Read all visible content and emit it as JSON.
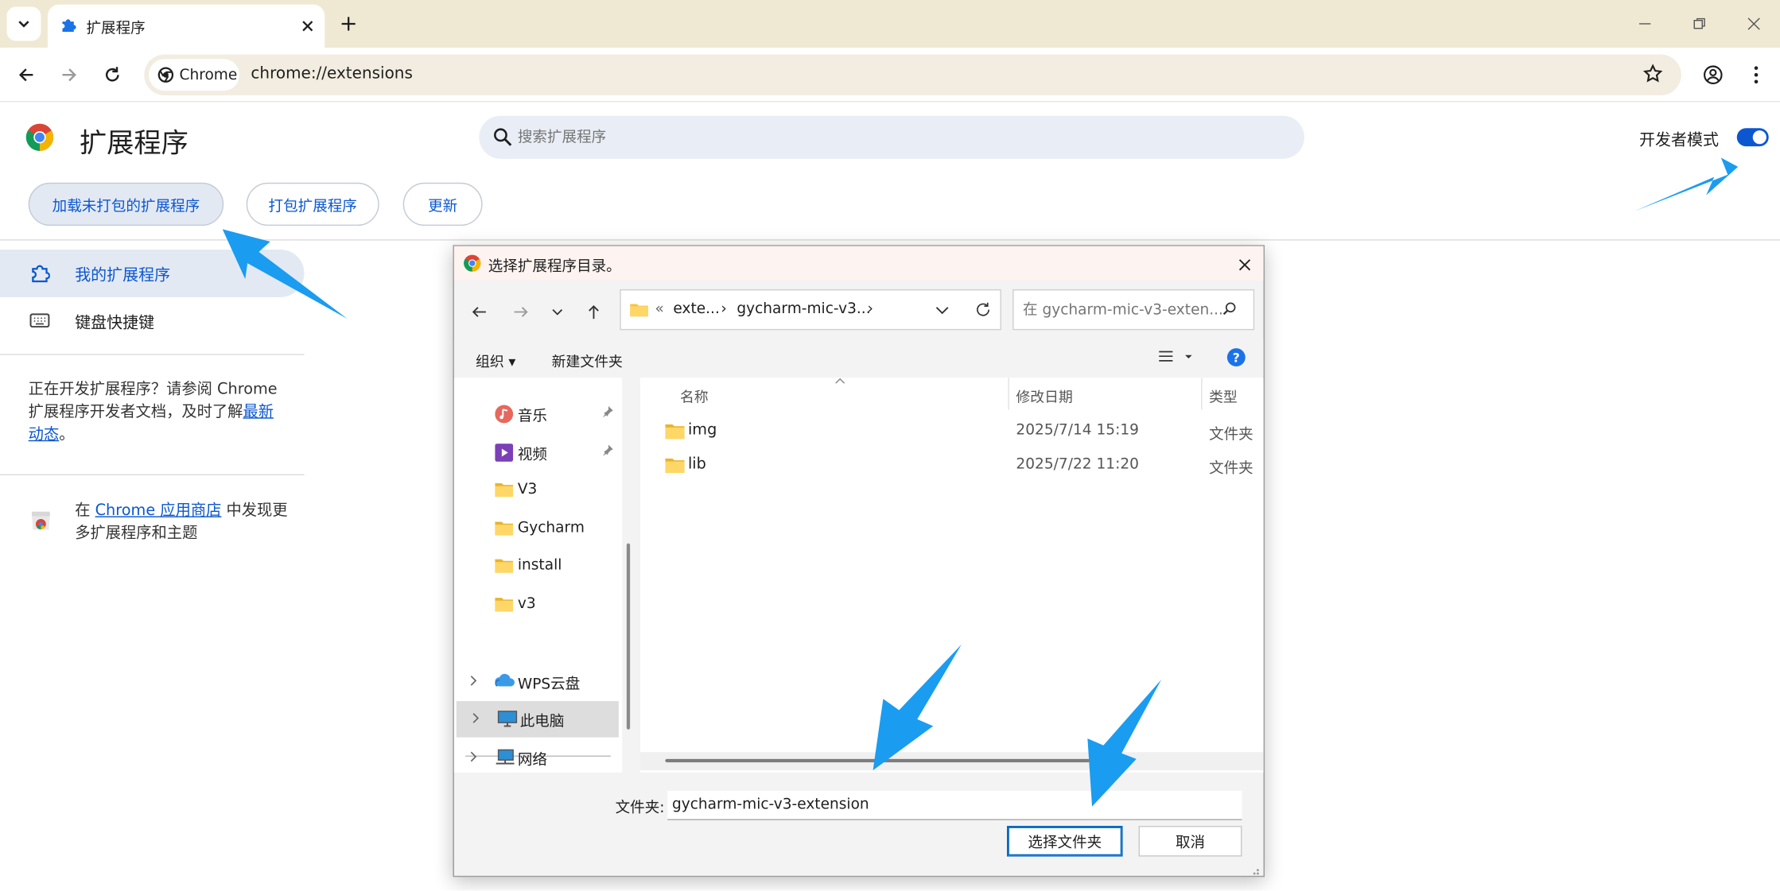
{
  "browser": {
    "tab_title": "扩展程序",
    "chip_label": "Chrome",
    "url": "chrome://extensions"
  },
  "header": {
    "title": "扩展程序",
    "search_placeholder": "搜索扩展程序",
    "dev_mode_label": "开发者模式",
    "dev_mode_on": true
  },
  "actions": {
    "load_unpacked": "加载未打包的扩展程序",
    "pack": "打包扩展程序",
    "update": "更新"
  },
  "sidebar": {
    "items": [
      {
        "label": "我的扩展程序",
        "icon": "puzzle-icon",
        "selected": true
      },
      {
        "label": "键盘快捷键",
        "icon": "keyboard-icon",
        "selected": false
      }
    ],
    "dev_note_prefix": "正在开发扩展程序？请参阅 Chrome 扩展程序开发者文档，及时了解",
    "dev_note_link": "最新动态",
    "dev_note_suffix": "。",
    "store_prefix": "在 ",
    "store_link": "Chrome 应用商店",
    "store_suffix": " 中发现更多扩展程序和主题"
  },
  "dialog": {
    "title": "选择扩展程序目录。",
    "breadcrumb": [
      "«",
      "exte...",
      "›",
      "gycharm-mic-v3...",
      "›"
    ],
    "search_placeholder": "在 gycharm-mic-v3-exten...",
    "organize": "组织 ▾",
    "new_folder": "新建文件夹",
    "help": "?",
    "nav_items": [
      {
        "label": "音乐",
        "icon": "music-icon",
        "pinned": true
      },
      {
        "label": "视频",
        "icon": "video-icon",
        "pinned": true
      },
      {
        "label": "V3",
        "icon": "folder-icon",
        "pinned": false
      },
      {
        "label": "Gycharm",
        "icon": "folder-icon",
        "pinned": false
      },
      {
        "label": "install",
        "icon": "folder-icon",
        "pinned": false
      },
      {
        "label": "v3",
        "icon": "folder-icon",
        "pinned": false
      }
    ],
    "nav_roots": [
      {
        "label": "WPS云盘",
        "icon": "cloud-icon",
        "selected": false
      },
      {
        "label": "此电脑",
        "icon": "computer-icon",
        "selected": true
      },
      {
        "label": "网络",
        "icon": "network-icon",
        "selected": false
      }
    ],
    "columns": [
      "名称",
      "修改日期",
      "类型"
    ],
    "files": [
      {
        "name": "img",
        "date": "2025/7/14 15:19",
        "type": "文件夹"
      },
      {
        "name": "lib",
        "date": "2025/7/22 11:20",
        "type": "文件夹"
      }
    ],
    "folder_label": "文件夹:",
    "folder_value": "gycharm-mic-v3-extension",
    "select_button": "选择文件夹",
    "cancel_button": "取消"
  },
  "colors": {
    "accent": "#0b57d0",
    "annotation_arrow": "#1a9cf0",
    "titlebar": "#efe9d4"
  }
}
